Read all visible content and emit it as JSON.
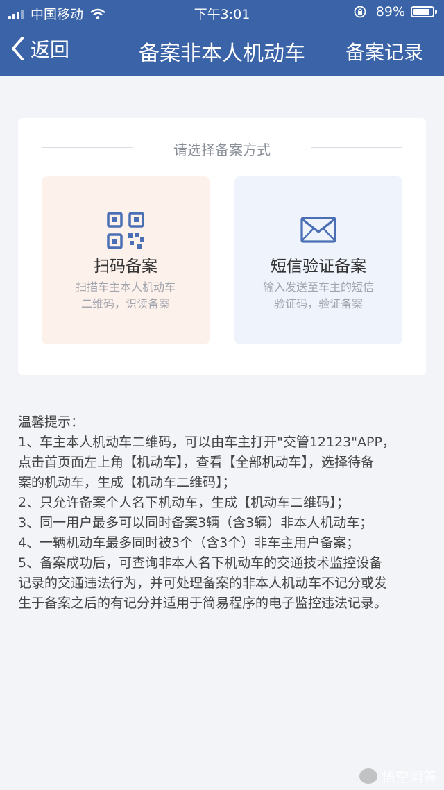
{
  "status_bar": {
    "carrier": "中国移动",
    "time": "下午3:01",
    "battery": "89%",
    "battery_level": 0.89
  },
  "nav": {
    "back_label": "返回",
    "title": "备案非本人机动车",
    "right_label": "备案记录"
  },
  "method_section": {
    "title": "请选择备案方式",
    "options": [
      {
        "icon": "qr-code-icon",
        "name": "扫码备案",
        "desc_line1": "扫描车主本人机动车",
        "desc_line2": "二维码，识读备案",
        "accent": "#4a6fb5",
        "bg": "#fdf1ec"
      },
      {
        "icon": "envelope-icon",
        "name": "短信验证备案",
        "desc_line1": "输入发送至车主的短信",
        "desc_line2": "验证码，验证备案",
        "accent": "#4a6fb5",
        "bg": "#eff3fb"
      }
    ]
  },
  "tips": {
    "heading": "温馨提示：",
    "lines": [
      "1、车主本人机动车二维码，可以由车主打开\"交管12123\"APP，",
      "点击首页面左上角【机动车】，查看【全部机动车】，选择待备",
      "案的机动车，生成【机动车二维码】；",
      "2、只允许备案个人名下机动车，生成【机动车二维码】；",
      "3、同一用户最多可以同时备案3辆（含3辆）非本人机动车；",
      "4、一辆机动车最多同时被3个（含3个）非车主用户备案；",
      "5、备案成功后，可查询非本人名下机动车的交通技术监控设备",
      "记录的交通违法行为，并可处理备案的非本人机动车不记分或发",
      "生于备案之后的有记分并适用于简易程序的电子监控违法记录。"
    ]
  },
  "watermark": {
    "text": "悟空问答"
  },
  "colors": {
    "header": "#3a63a8",
    "background": "#f2f4f8"
  }
}
